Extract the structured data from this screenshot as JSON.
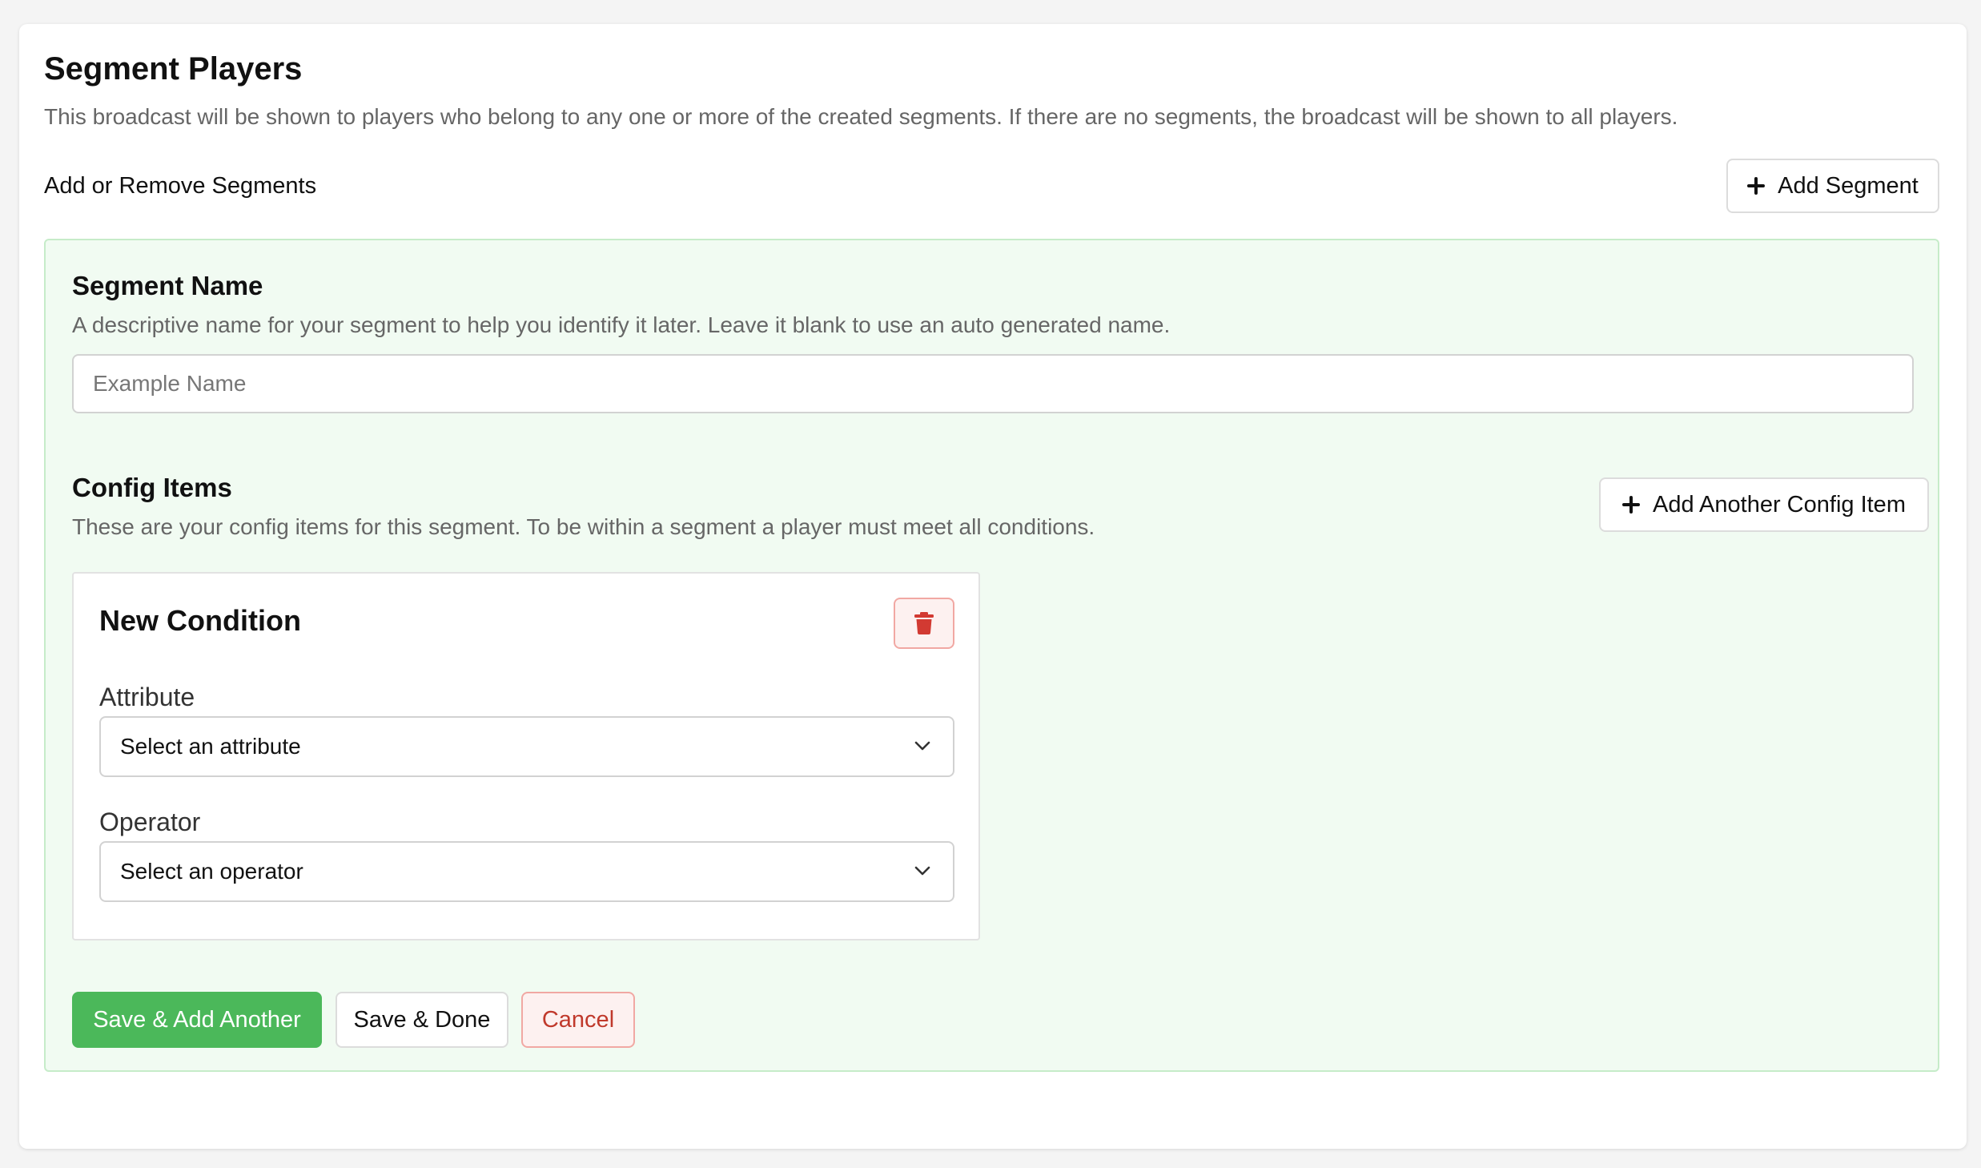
{
  "header": {
    "title": "Segment Players",
    "description": "This broadcast will be shown to players who belong to any one or more of the created segments. If there are no segments, the broadcast will be shown to all players."
  },
  "segments_bar": {
    "label": "Add or Remove Segments",
    "add_segment_label": "Add Segment"
  },
  "segment_form": {
    "name_title": "Segment Name",
    "name_description": "A descriptive name for your segment to help you identify it later. Leave it blank to use an auto generated name.",
    "name_value": "",
    "name_placeholder": "Example Name",
    "config_title": "Config Items",
    "config_description": "These are your config items for this segment. To be within a segment a player must meet all conditions.",
    "add_config_label": "Add Another Config Item",
    "conditions": [
      {
        "title": "New Condition",
        "attribute_label": "Attribute",
        "attribute_value": "Select an attribute",
        "operator_label": "Operator",
        "operator_value": "Select an operator"
      }
    ],
    "actions": {
      "save_add_label": "Save & Add Another",
      "save_done_label": "Save & Done",
      "cancel_label": "Cancel"
    }
  },
  "colors": {
    "panel_bg": "#f1fbf2",
    "panel_border": "#c6ecc9",
    "primary_green": "#4bb85a",
    "danger_red": "#c0392b",
    "danger_bg": "#fdf1f0"
  },
  "icons": {
    "add_segment": "plus-icon",
    "add_config": "plus-icon",
    "delete_condition": "trash-icon",
    "select_chevron": "chevron-down-icon"
  }
}
